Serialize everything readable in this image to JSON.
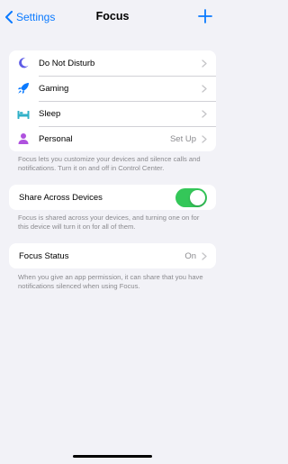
{
  "nav": {
    "back_label": "Settings",
    "title": "Focus",
    "add_icon": "plus-icon"
  },
  "focus_modes": [
    {
      "label": "Do Not Disturb",
      "icon": "moon-icon",
      "icon_color": "#5e5ce6",
      "value": ""
    },
    {
      "label": "Gaming",
      "icon": "rocket-icon",
      "icon_color": "#0a7aff",
      "value": ""
    },
    {
      "label": "Sleep",
      "icon": "bed-icon",
      "icon_color": "#30b0c7",
      "value": ""
    },
    {
      "label": "Personal",
      "icon": "person-icon",
      "icon_color": "#af52de",
      "value": "Set Up"
    }
  ],
  "focus_note": "Focus lets you customize your devices and silence calls and notifications. Turn it on and off in Control Center.",
  "share": {
    "label": "Share Across Devices",
    "enabled": true,
    "toggle_color": "#34c759",
    "note": "Focus is shared across your devices, and turning one on for this device will turn it on for all of them."
  },
  "status": {
    "label": "Focus Status",
    "value": "On",
    "note": "When you give an app permission, it can share that you have notifications silenced when using Focus."
  }
}
